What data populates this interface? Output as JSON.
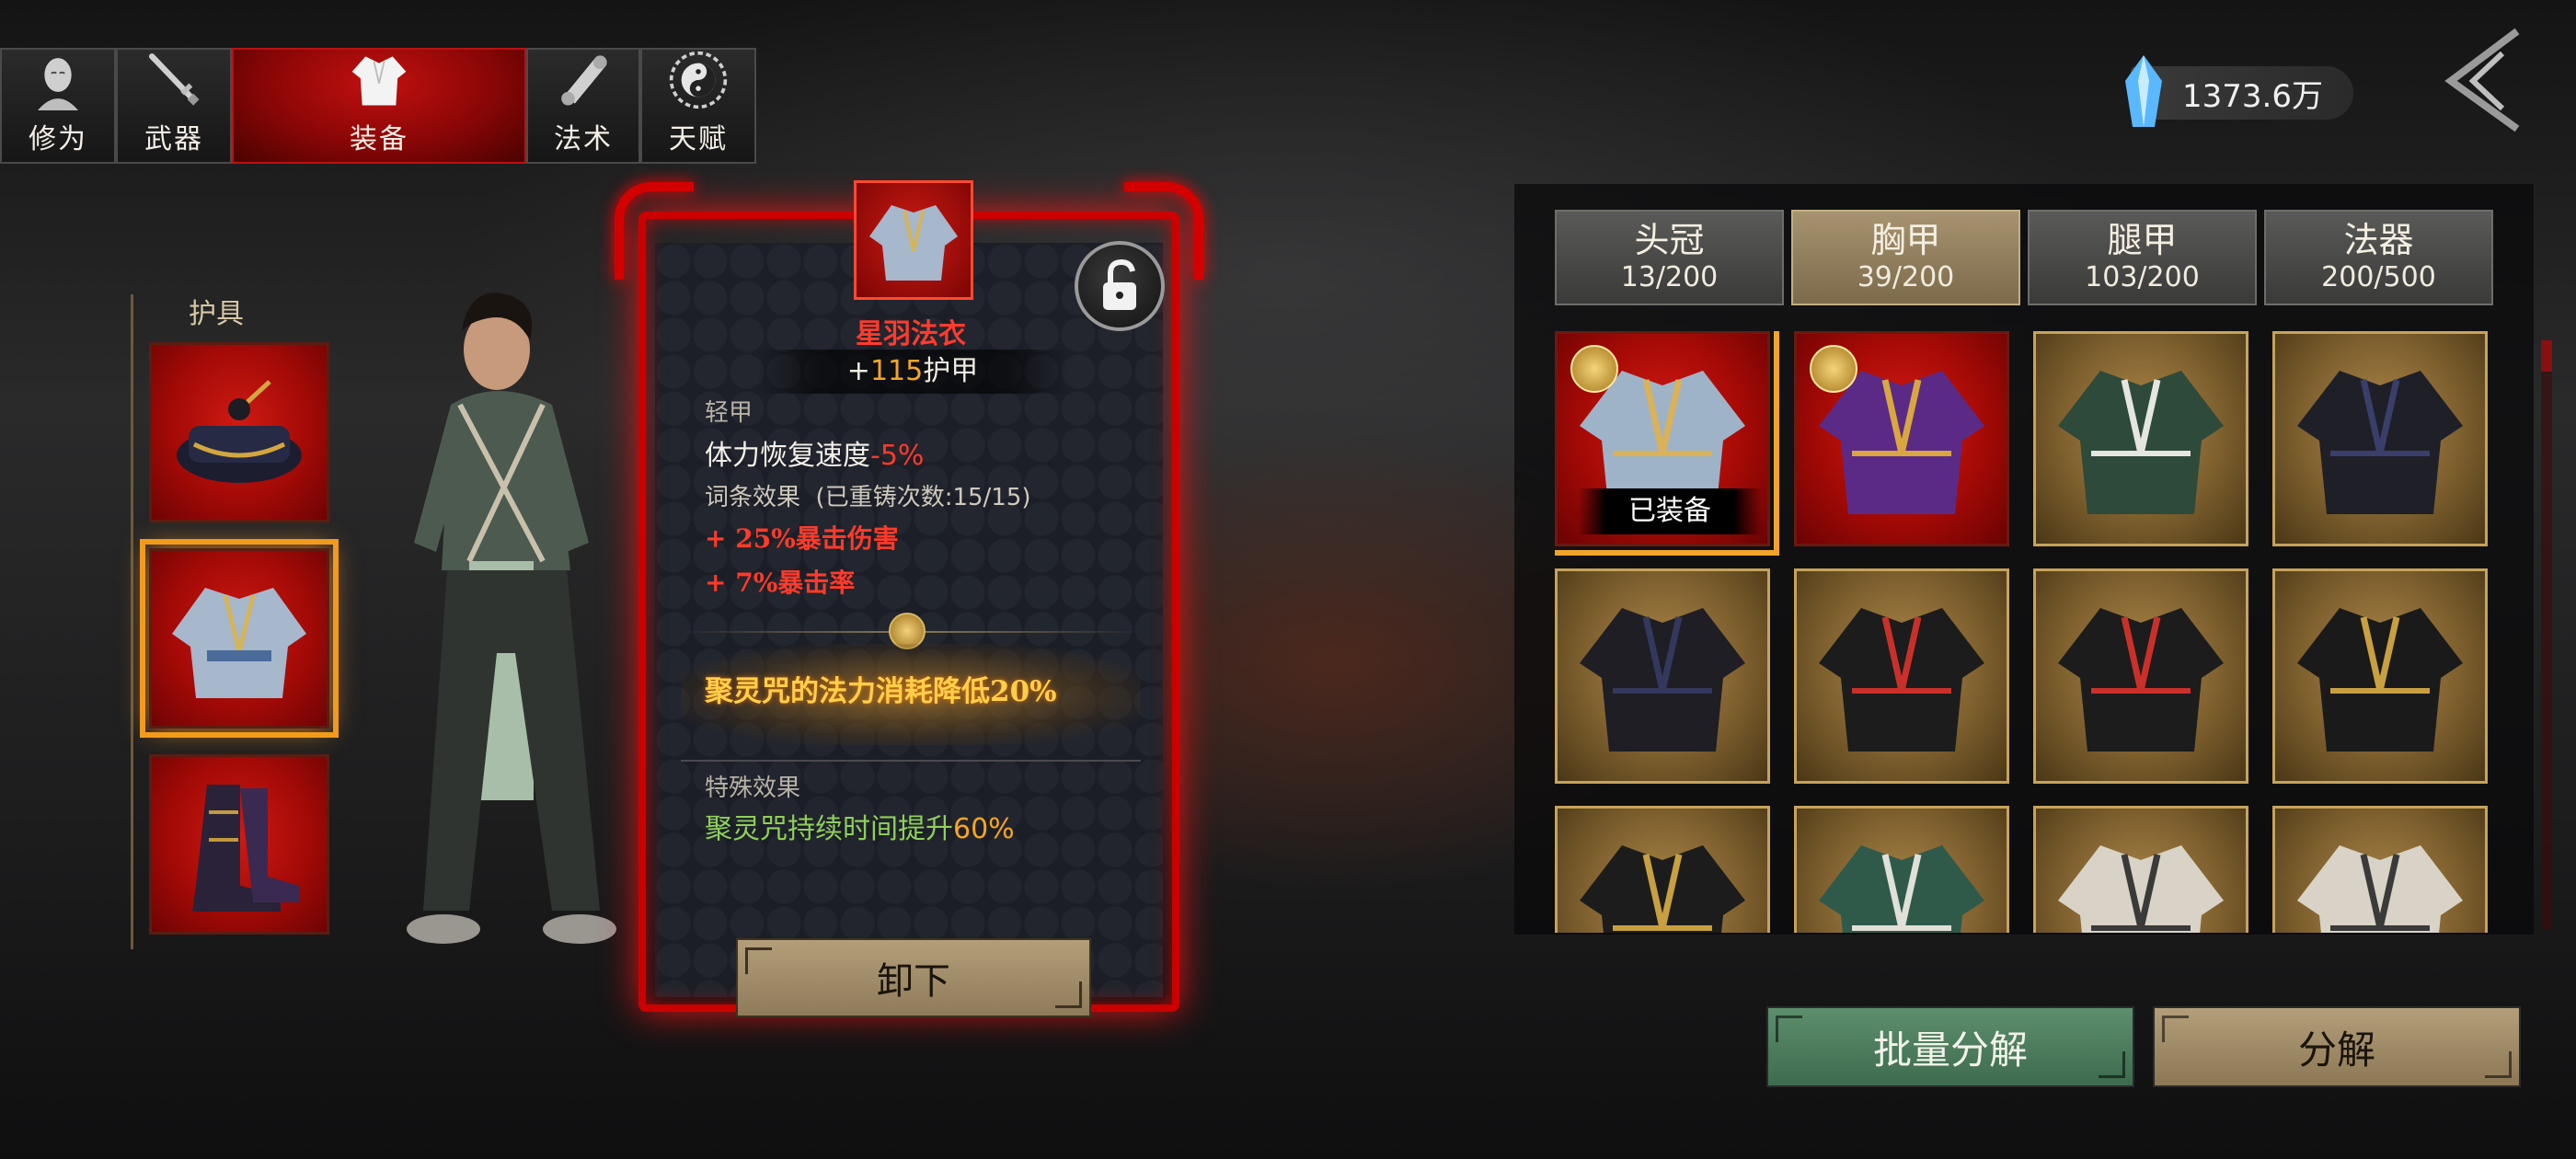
{
  "tabs": [
    {
      "label": "修为",
      "icon": "cultivator-head-icon",
      "active": false
    },
    {
      "label": "武器",
      "icon": "sword-icon",
      "active": false
    },
    {
      "label": "装备",
      "icon": "robe-icon",
      "active": true
    },
    {
      "label": "法术",
      "icon": "scroll-icon",
      "active": false
    },
    {
      "label": "天赋",
      "icon": "yin-yang-icon",
      "active": false
    }
  ],
  "currency": {
    "amount": "1373.6万",
    "icon": "spirit-crystal-icon"
  },
  "slots": {
    "title": "护具",
    "items": [
      {
        "name": "head-slot",
        "icon": "hat-icon"
      },
      {
        "name": "chest-slot",
        "icon": "robe-icon",
        "selected": true
      },
      {
        "name": "leg-slot",
        "icon": "boots-icon"
      }
    ]
  },
  "detail": {
    "name": "星羽法衣",
    "armor_prefix": "+",
    "armor_value": "115",
    "armor_label": "护甲",
    "type": "轻甲",
    "stat_label": "体力恢复速度",
    "stat_value": "-5%",
    "affix_label": "词条效果",
    "reforge": "(已重铸次数:15/15)",
    "affixes": [
      "+ 25%暴击伤害",
      "+ 7%暴击率"
    ],
    "set_effect": "聚灵咒的法力消耗降低20%",
    "special_label": "特殊效果",
    "special_text": "聚灵咒持续时间提升",
    "special_value": "60%",
    "unequip": "卸下"
  },
  "categories": [
    {
      "name": "头冠",
      "count": "13/200",
      "active": false
    },
    {
      "name": "胸甲",
      "count": "39/200",
      "active": true
    },
    {
      "name": "腿甲",
      "count": "103/200",
      "active": false
    },
    {
      "name": "法器",
      "count": "200/500",
      "active": false
    }
  ],
  "inventory": {
    "equipped_label": "已装备",
    "items": [
      {
        "style": "red",
        "badge": true,
        "equipped": true,
        "robe": "#9fb3c8",
        "trim": "#d9b25a"
      },
      {
        "style": "red",
        "badge": true,
        "equipped": false,
        "robe": "#5b2a86",
        "trim": "#d9a640"
      },
      {
        "style": "gold",
        "badge": false,
        "equipped": false,
        "robe": "#2e4a3a",
        "trim": "#e6e6e0"
      },
      {
        "style": "gold",
        "badge": false,
        "equipped": false,
        "robe": "#1f1f28",
        "trim": "#3a3e6a"
      },
      {
        "style": "gold",
        "badge": false,
        "equipped": false,
        "robe": "#1e1e24",
        "trim": "#34385e"
      },
      {
        "style": "gold",
        "badge": false,
        "equipped": false,
        "robe": "#1c1c1c",
        "trim": "#c9302a"
      },
      {
        "style": "gold",
        "badge": false,
        "equipped": false,
        "robe": "#1c1c1c",
        "trim": "#c9302a"
      },
      {
        "style": "gold",
        "badge": false,
        "equipped": false,
        "robe": "#1a1a1a",
        "trim": "#c9a040"
      },
      {
        "style": "gold",
        "badge": false,
        "equipped": false,
        "robe": "#1c1c1c",
        "trim": "#c9a040"
      },
      {
        "style": "gold",
        "badge": false,
        "equipped": false,
        "robe": "#2f5a4a",
        "trim": "#e0e0d8"
      },
      {
        "style": "gold",
        "badge": false,
        "equipped": false,
        "robe": "#d8d3c6",
        "trim": "#3a3a3a"
      },
      {
        "style": "gold",
        "badge": false,
        "equipped": false,
        "robe": "#d8d3c6",
        "trim": "#3a3a3a"
      }
    ]
  },
  "actions": {
    "batch": "批量分解",
    "decompose": "分解"
  },
  "colors": {
    "accent_red": "#c00000",
    "gold": "#c6a35a",
    "green_btn": "#4e7d5e",
    "tan_btn": "#a08c68"
  }
}
